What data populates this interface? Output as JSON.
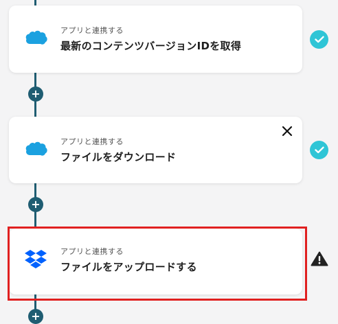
{
  "flow": {
    "steps": [
      {
        "subtitle": "アプリと連携する",
        "title": "最新のコンテンツバージョンIDを取得",
        "app_icon": "salesforce-cloud-icon",
        "status": "complete"
      },
      {
        "subtitle": "アプリと連携する",
        "title": "ファイルをダウンロード",
        "app_icon": "salesforce-cloud-icon",
        "status": "complete"
      },
      {
        "subtitle": "アプリと連携する",
        "title": "ファイルをアップロードする",
        "app_icon": "dropbox-icon",
        "status": "warning"
      }
    ],
    "add_label": "+"
  },
  "colors": {
    "rail": "#1f5d72",
    "check": "#2fc5d6",
    "salesforce": "#1ba1e0",
    "dropbox": "#0061fe",
    "highlight": "#e02020",
    "warning": "#222222"
  }
}
